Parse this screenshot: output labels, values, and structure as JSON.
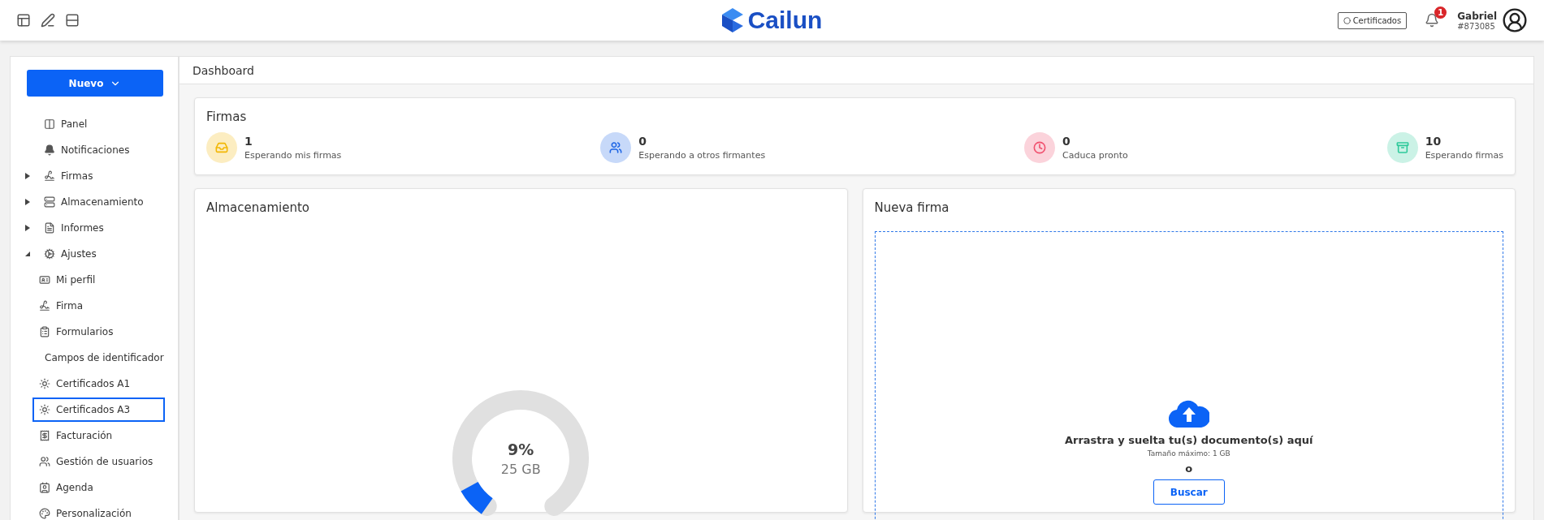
{
  "header": {
    "logo": "Cailun",
    "certificates_button": "Certificados",
    "notifications_count": "1",
    "user": {
      "name": "Gabriel",
      "id": "#873085"
    }
  },
  "sidebar": {
    "new_button": "Nuevo",
    "items": [
      {
        "label": "Panel",
        "selected": false
      },
      {
        "label": "Notificaciones",
        "selected": false
      },
      {
        "label": "Firmas",
        "selected": false,
        "expanded": false
      },
      {
        "label": "Almacenamiento",
        "selected": false,
        "expanded": false
      },
      {
        "label": "Informes",
        "selected": false,
        "expanded": false
      },
      {
        "label": "Ajustes",
        "selected": false,
        "expanded": true,
        "children": [
          {
            "label": "Mi perfil",
            "selected": false
          },
          {
            "label": "Firma",
            "selected": false
          },
          {
            "label": "Formularios",
            "selected": false
          },
          {
            "label": "Campos de identificador",
            "selected": false
          },
          {
            "label": "Certificados A1",
            "selected": false
          },
          {
            "label": "Certificados A3",
            "selected": true
          },
          {
            "label": "Facturación",
            "selected": false
          },
          {
            "label": "Gestión de usuarios",
            "selected": false
          },
          {
            "label": "Agenda",
            "selected": false
          },
          {
            "label": "Personalización",
            "selected": false
          }
        ]
      }
    ]
  },
  "breadcrumb": "Dashboard",
  "firmas": {
    "title": "Firmas",
    "stats": [
      {
        "count": "1",
        "label": "Esperando mis firmas",
        "color": "#f2b705"
      },
      {
        "count": "0",
        "label": "Esperando a otros firmantes",
        "color": "#1f66e5"
      },
      {
        "count": "0",
        "label": "Caduca pronto",
        "color": "#f0506e"
      },
      {
        "count": "10",
        "label": "Esperando firmas",
        "color": "#2ec99a"
      }
    ]
  },
  "storage": {
    "title": "Almacenamiento",
    "percent": "9%",
    "amount": "25 GB",
    "level": 0.09
  },
  "upload": {
    "title": "Nueva firma",
    "drop_text": "Arrastra y suelta tu(s) documento(s) aquí",
    "max_size": "Tamaño máximo: 1 GB",
    "or": "o",
    "button": "Buscar"
  }
}
